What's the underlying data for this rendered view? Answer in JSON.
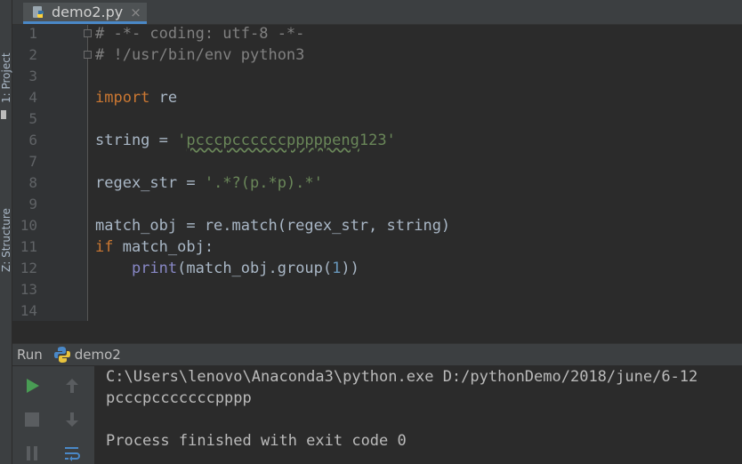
{
  "left_strip": {
    "project_label": "1: Project",
    "structure_label": "Z: Structure"
  },
  "tab": {
    "file_name": "demo2.py",
    "close_glyph": "×",
    "icon": "python-file-icon"
  },
  "editor": {
    "line_numbers": [
      "1",
      "2",
      "3",
      "4",
      "5",
      "6",
      "7",
      "8",
      "9",
      "10",
      "11",
      "12",
      "13",
      "14"
    ],
    "lines": {
      "l1": "# -*- coding: utf-8 -*-",
      "l2": "# !/usr/bin/env python3",
      "l4_kw": "import",
      "l4_rest": " re",
      "l6_a": "string = ",
      "l6_q1": "'",
      "l6_str": "pcccpccccccpppppeng",
      "l6_q2": "123'",
      "l8_a": "regex_str = ",
      "l8_str": "'.*?(p.*p).*'",
      "l10_a": "match_obj = re.match(regex_str, string)",
      "l11_kw": "if",
      "l11_rest": " match_obj:",
      "l12_indent": "    ",
      "l12_fn": "print",
      "l12_a": "(match_obj.group(",
      "l12_num": "1",
      "l12_b": "))"
    }
  },
  "run_panel": {
    "title": "Run",
    "config_name": "demo2",
    "config_icon": "python-icon",
    "buttons": [
      "run-icon",
      "arrow-up-icon",
      "stop-icon",
      "arrow-down-icon",
      "pause-icon",
      "soft-wrap-icon"
    ],
    "output": [
      "C:\\Users\\lenovo\\Anaconda3\\python.exe D:/pythonDemo/2018/june/6-12",
      "pcccpcccccccpppp",
      "",
      "Process finished with exit code 0"
    ]
  },
  "colors": {
    "background": "#2b2b2b",
    "keyword": "#cc7832",
    "string": "#6a8759",
    "comment": "#808080",
    "builtin": "#8888c6",
    "number": "#6897bb",
    "run_green": "#499c54"
  }
}
